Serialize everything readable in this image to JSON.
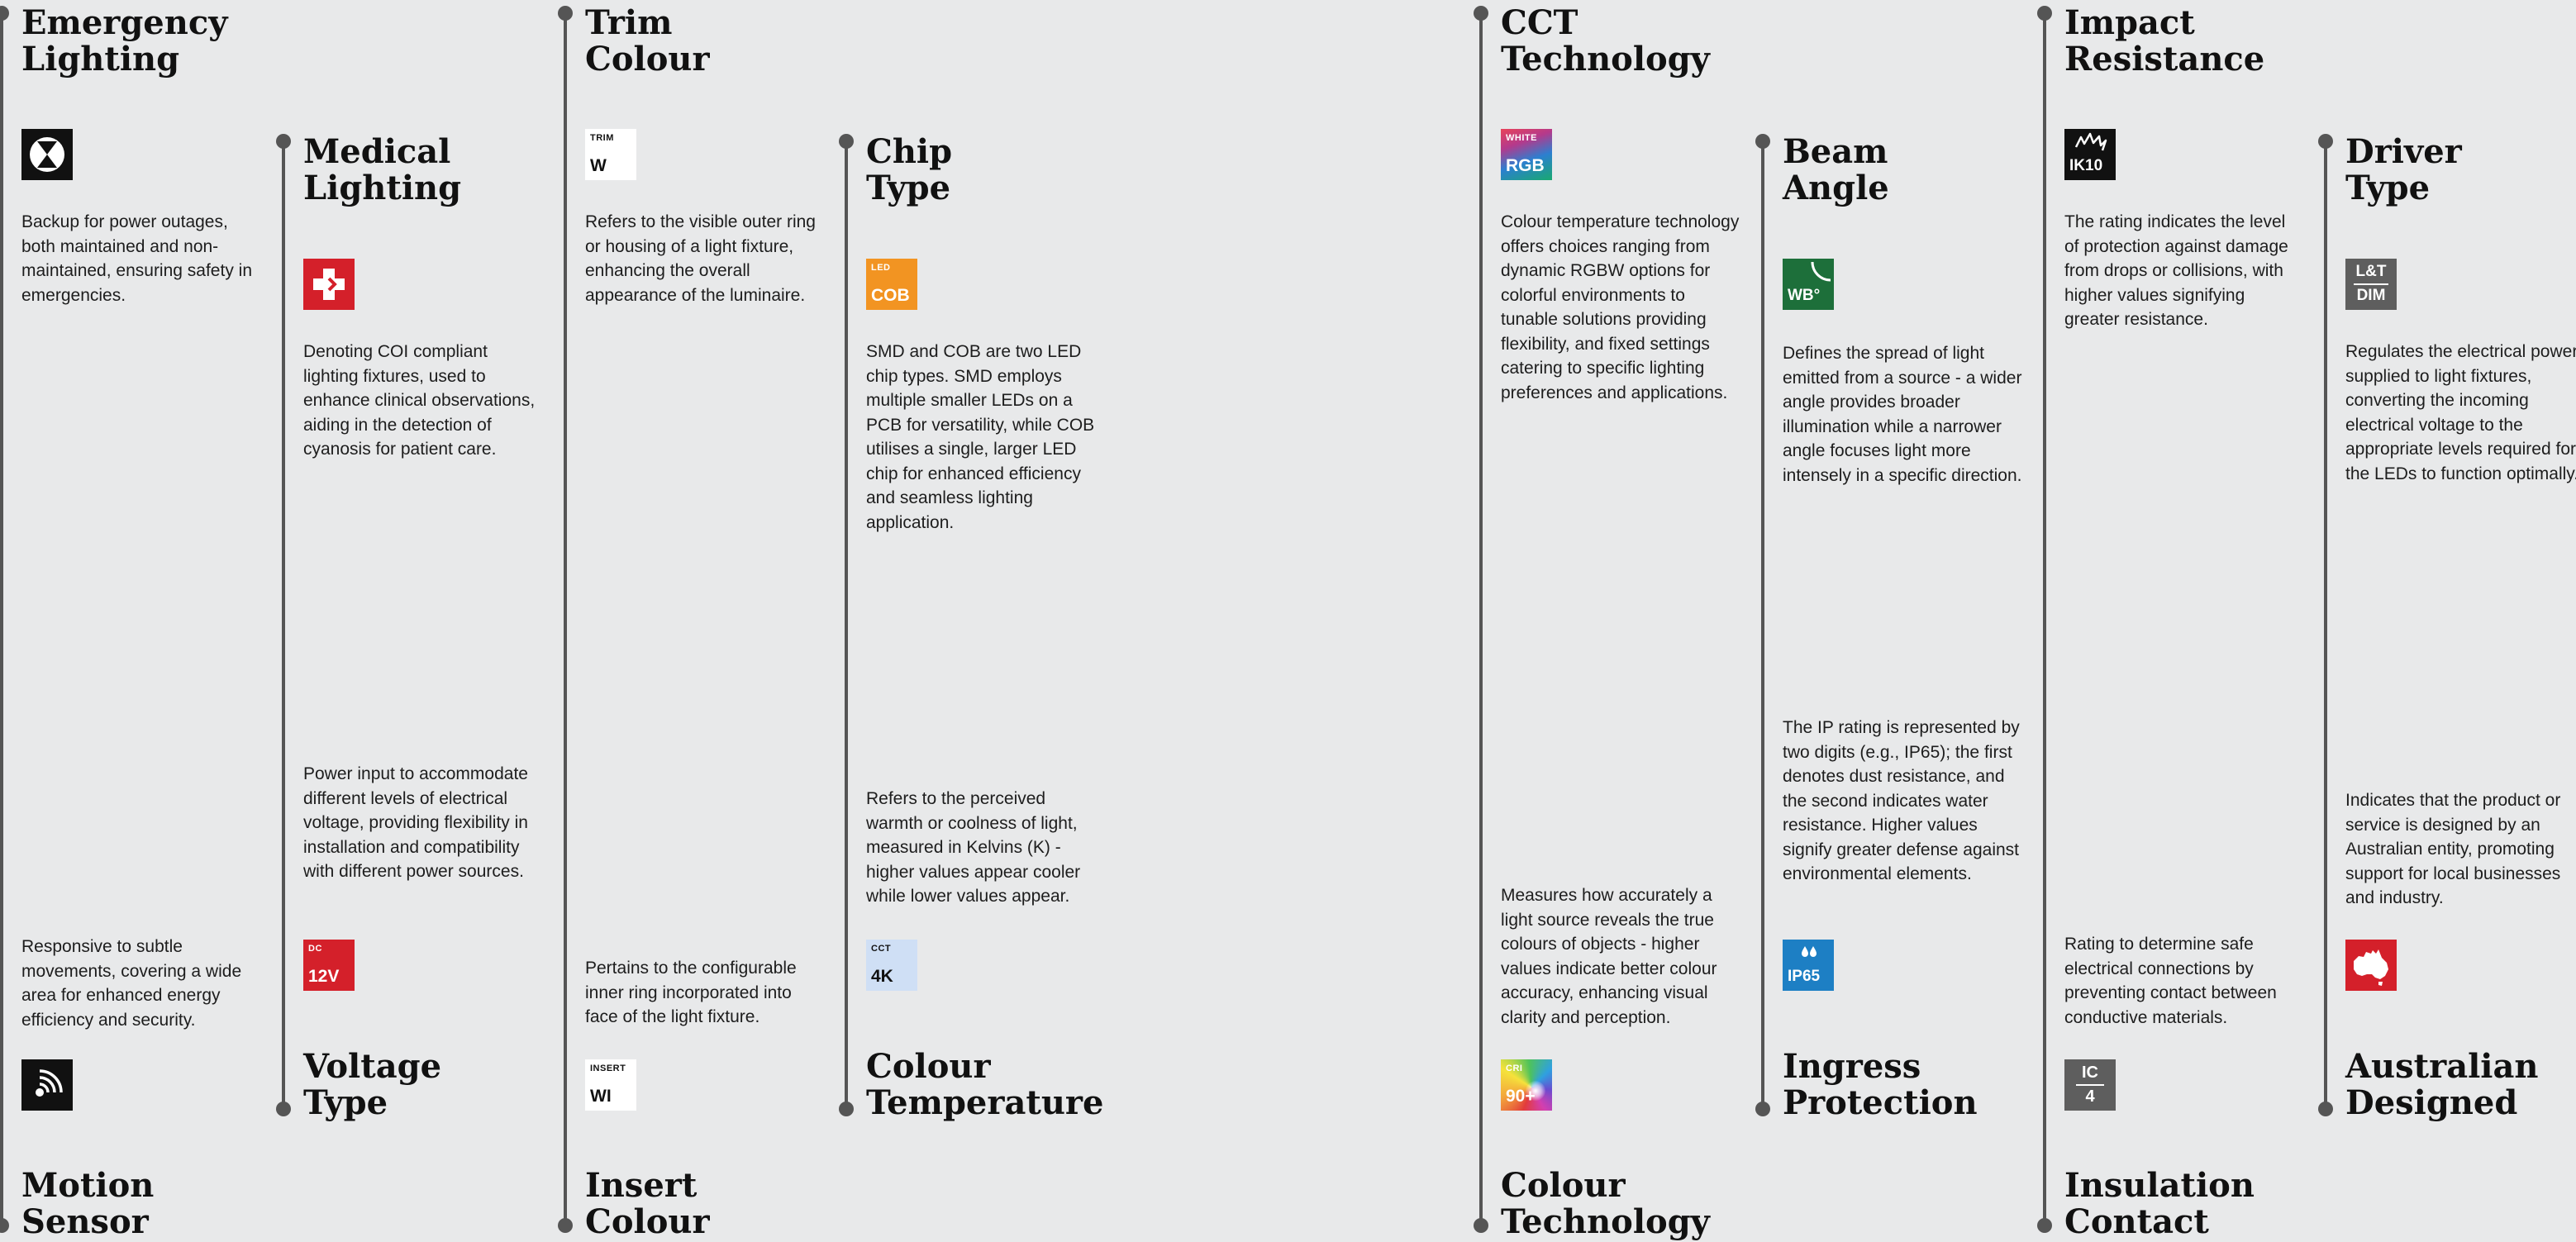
{
  "columns": [
    {
      "top_title": [
        "Emergency",
        "Lighting"
      ],
      "top_desc": "Backup for power outages, both maintained and non-maintained, ensuring safety in emergencies.",
      "top_icon": "emergency-icon",
      "bottom_desc": "Responsive to subtle movements, covering a wide area for enhanced energy efficiency and security.",
      "bottom_icon": "motion-sensor-icon",
      "bottom_title": [
        "Motion",
        "Sensor"
      ]
    },
    {
      "top_title": [
        "Medical",
        "Lighting"
      ],
      "top_desc": "Denoting COI compliant lighting fixtures, used to enhance clinical observations, aiding in the detection of cyanosis for patient care.",
      "top_icon": "medical-cross-icon",
      "bottom_desc": "Power input to accommodate different levels of electrical voltage, providing flexibility in installation and compatibility with different power sources.",
      "bottom_icon_small": "DC",
      "bottom_icon_big": "12V",
      "bottom_title": [
        "Voltage",
        "Type"
      ]
    },
    {
      "top_title": [
        "Trim",
        "Colour"
      ],
      "top_icon_small": "TRIM",
      "top_icon_big": "W",
      "top_desc": "Refers to the visible outer ring or housing of a light fixture, enhancing the overall appearance of the luminaire.",
      "bottom_desc": "Pertains to the configurable inner ring incorporated into face of the light fixture.",
      "bottom_icon_small": "INSERT",
      "bottom_icon_big": "WI",
      "bottom_title": [
        "Insert",
        "Colour"
      ]
    },
    {
      "top_title": [
        "Chip",
        "Type"
      ],
      "top_icon_small": "LED",
      "top_icon_big": "COB",
      "top_desc": "SMD and COB are two LED chip types. SMD employs multiple smaller LEDs on a PCB for versatility, while COB utilises a single, larger LED chip for enhanced efficiency and seamless lighting application.",
      "bottom_desc": "Refers to the perceived warmth or coolness of light, measured in Kelvins (K) - higher values appear cooler while lower values appear.",
      "bottom_icon_small": "CCT",
      "bottom_icon_big": "4K",
      "bottom_title": [
        "Colour",
        "Temperature"
      ]
    },
    {
      "top_title": [
        "CCT",
        "Technology"
      ],
      "top_icon_small": "WHITE",
      "top_icon_big": "RGB",
      "top_desc": "Colour temperature technology offers choices ranging from dynamic RGBW options for colorful environments to tunable solutions providing flexibility, and fixed settings catering to specific lighting preferences and applications.",
      "bottom_desc": "Measures how accurately a light source reveals the true colours of objects - higher values indicate better colour accuracy, enhancing visual clarity and perception.",
      "bottom_icon_small": "CRI",
      "bottom_icon_big": "90+",
      "bottom_title": [
        "Colour",
        "Technology"
      ]
    },
    {
      "top_title": [
        "Beam",
        "Angle"
      ],
      "top_icon_big": "WB°",
      "top_desc": "Defines the spread of light emitted from a source - a wider angle provides broader illumination while a narrower angle focuses light more intensely in a specific direction.",
      "bottom_desc": "The IP rating is represented by two digits (e.g., IP65); the first denotes dust resistance, and the second indicates water resistance. Higher values signify greater defense against environmental elements.",
      "bottom_icon_big": "IP65",
      "bottom_title": [
        "Ingress",
        "Protection"
      ]
    },
    {
      "top_title": [
        "Impact",
        "Resistance"
      ],
      "top_icon_big": "IK10",
      "top_desc": "The rating indicates the level of protection against damage from drops or collisions, with higher values signifying greater resistance.",
      "bottom_desc": "Rating to determine safe electrical connections by preventing contact between conductive materials.",
      "bottom_icon_top": "IC",
      "bottom_icon_bottom": "4",
      "bottom_title": [
        "Insulation",
        "Contact"
      ]
    },
    {
      "top_title": [
        "Driver",
        "Type"
      ],
      "top_icon_top": "L&T",
      "top_icon_bottom": "DIM",
      "top_desc": "Regulates the electrical power supplied to light fixtures, converting the incoming electrical voltage to the appropriate levels required for the LEDs to function optimally.",
      "bottom_desc": "Indicates that the product or service is designed by an Australian entity, promoting support for local businesses and industry.",
      "bottom_icon": "australia-map-icon",
      "bottom_title": [
        "Australian",
        "Designed"
      ]
    }
  ]
}
